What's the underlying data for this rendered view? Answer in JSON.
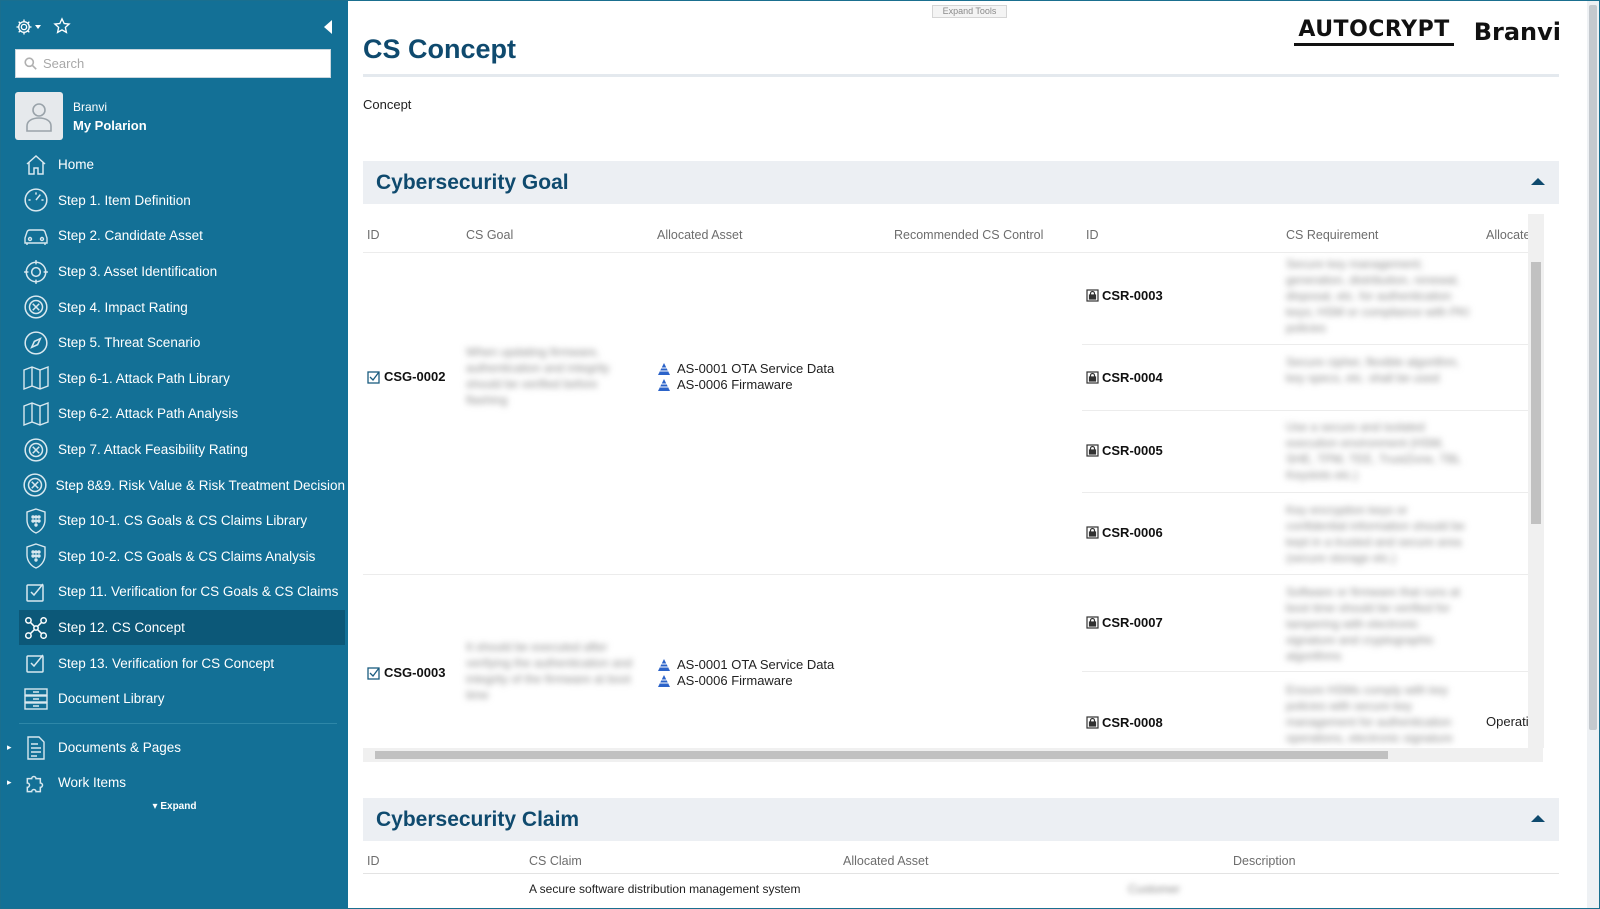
{
  "sidebar": {
    "search_placeholder": "Search",
    "user": {
      "name": "Branvi",
      "link": "My Polarion"
    },
    "nav": [
      {
        "label": "Home",
        "icon": "home-icon"
      },
      {
        "label": "Step 1. Item Definition",
        "icon": "gauge-icon"
      },
      {
        "label": "Step 2. Candidate Asset",
        "icon": "car-icon"
      },
      {
        "label": "Step 3. Asset Identification",
        "icon": "target-icon"
      },
      {
        "label": "Step 4. Impact Rating",
        "icon": "crosshair-icon"
      },
      {
        "label": "Step 5. Threat Scenario",
        "icon": "compass-icon"
      },
      {
        "label": "Step 6-1. Attack Path Library",
        "icon": "map-icon"
      },
      {
        "label": "Step 6-2. Attack Path Analysis",
        "icon": "map-icon"
      },
      {
        "label": "Step 7. Attack Feasibility Rating",
        "icon": "crosshair-icon"
      },
      {
        "label": "Step 8&9. Risk Value & Risk Treatment Decision",
        "icon": "crosshair-icon"
      },
      {
        "label": "Step 10-1. CS Goals & CS Claims Library",
        "icon": "shield-icon"
      },
      {
        "label": "Step 10-2. CS Goals & CS Claims Analysis",
        "icon": "shield-icon"
      },
      {
        "label": "Step 11. Verification for CS Goals & CS Claims",
        "icon": "checklist-icon"
      },
      {
        "label": "Step 12. CS Concept",
        "icon": "network-icon"
      },
      {
        "label": "Step 13. Verification for CS Concept",
        "icon": "checklist-icon"
      },
      {
        "label": "Document Library",
        "icon": "archive-icon"
      }
    ],
    "tree": [
      {
        "label": "Documents & Pages",
        "icon": "document-icon"
      },
      {
        "label": "Work Items",
        "icon": "puzzle-icon"
      }
    ],
    "expand_label": "Expand"
  },
  "main": {
    "expand_tools": "Expand Tools",
    "title": "CS Concept",
    "logos": {
      "left": "AUTOCRYPT",
      "right": "Branvi"
    },
    "concept_text": "Concept",
    "goal_section": {
      "title": "Cybersecurity Goal",
      "headers": [
        "ID",
        "CS Goal",
        "Allocated Asset",
        "Recommended CS Control",
        "ID",
        "CS Requirement",
        "Allocated"
      ],
      "goals": [
        {
          "id": "CSG-0002",
          "goal_text": "When updating firmware, authentication and integrity should be verified before flashing",
          "assets": [
            "AS-0001 OTA Service Data",
            "AS-0006 Firmaware"
          ],
          "requirements": [
            {
              "id": "CSR-0003",
              "text": "Secure key management; generation, distribution, renewal, disposal, etc. for authentication keys; HSM or compliance with PKI policies"
            },
            {
              "id": "CSR-0004",
              "text": "Secure cipher, flexible algorithm, key specs, etc. shall be used"
            },
            {
              "id": "CSR-0005",
              "text": "Use a secure and isolated execution environment (HSM, SHE, TPM, TEE, TrustZone, TBL Keyslots etc.)"
            },
            {
              "id": "CSR-0006",
              "text": "Key encryption keys or confidential information should be kept in a trusted and secure area (secure storage etc.)"
            }
          ]
        },
        {
          "id": "CSG-0003",
          "goal_text": "It should be executed after verifying the authentication and integrity of the firmware at boot time",
          "assets": [
            "AS-0001 OTA Service Data",
            "AS-0006 Firmaware"
          ],
          "requirements": [
            {
              "id": "CSR-0007",
              "text": "Software or firmware that runs at boot time should be verified for tampering with electronic signature and cryptographic algorithms"
            },
            {
              "id": "CSR-0008",
              "text": "Ensure HSMs comply with key policies with secure key management for authentication operations, electronic signature"
            }
          ],
          "allocated_partial": "Operatic"
        }
      ]
    },
    "claim_section": {
      "title": "Cybersecurity Claim",
      "headers": [
        "ID",
        "CS Claim",
        "Allocated Asset",
        "Description"
      ],
      "first_row_text": "A secure software distribution management system",
      "first_row_partial": "Customer"
    }
  }
}
